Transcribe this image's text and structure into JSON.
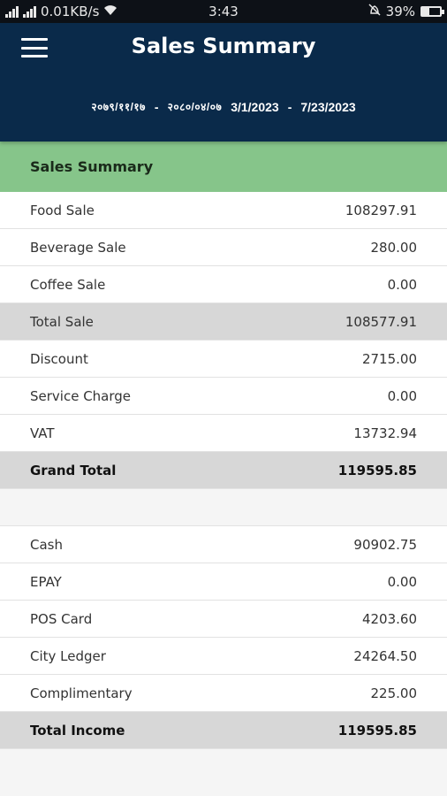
{
  "status_bar": {
    "network_speed": "0.01KB/s",
    "time": "3:43",
    "battery": "39%",
    "battery_level": 0.39
  },
  "header": {
    "title": "Sales Summary",
    "date_range": {
      "from_nepali": "२०७९/११/१७",
      "to_nepali": "२०८०/०४/०७",
      "from": "3/1/2023",
      "to": "7/23/2023",
      "separator": "-"
    }
  },
  "section": {
    "title": "Sales Summary"
  },
  "sales": [
    {
      "label": "Food Sale",
      "value": "108297.91"
    },
    {
      "label": "Beverage Sale",
      "value": "280.00"
    },
    {
      "label": "Coffee Sale",
      "value": "0.00"
    },
    {
      "label": "Total Sale",
      "value": "108577.91"
    },
    {
      "label": "Discount",
      "value": "2715.00"
    },
    {
      "label": "Service Charge",
      "value": "0.00"
    },
    {
      "label": "VAT",
      "value": "13732.94"
    },
    {
      "label": "Grand Total",
      "value": "119595.85"
    }
  ],
  "income": [
    {
      "label": "Cash",
      "value": "90902.75"
    },
    {
      "label": "EPAY",
      "value": "0.00"
    },
    {
      "label": "POS Card",
      "value": "4203.60"
    },
    {
      "label": "City Ledger",
      "value": "24264.50"
    },
    {
      "label": "Complimentary",
      "value": "225.00"
    },
    {
      "label": "Total Income",
      "value": "119595.85"
    }
  ],
  "colors": {
    "header_bg": "#0a2a4a",
    "section_bg": "#86c58a",
    "total_row_bg": "#d7d7d7"
  }
}
